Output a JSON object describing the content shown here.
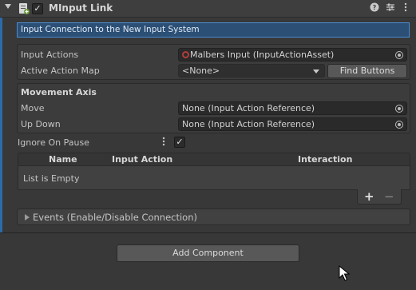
{
  "component": {
    "title": "MInput Link",
    "enabled_mark": "✓",
    "description": "Input Connection to the New Input System"
  },
  "header_icons": [
    "help-icon",
    "preset-icon",
    "context-menu-icon"
  ],
  "fields": {
    "input_actions_label": "Input Actions",
    "input_actions_value": "Malbers Input (InputActionAsset)",
    "active_action_map_label": "Active Action Map",
    "active_action_map_value": "<None>",
    "find_buttons_label": "Find Buttons"
  },
  "movement_axis": {
    "section_title": "Movement Axis",
    "move_label": "Move",
    "move_value": "None (Input Action Reference)",
    "up_down_label": "Up Down",
    "up_down_value": "None (Input Action Reference)"
  },
  "ignore_on_pause": {
    "label": "Ignore On Pause",
    "checked_mark": "✓"
  },
  "table": {
    "columns": [
      "Name",
      "Input Action",
      "Interaction"
    ],
    "empty_text": "List is Empty",
    "add_label": "+",
    "remove_label": "−"
  },
  "events": {
    "label": "Events (Enable/Disable Connection)"
  },
  "add_component_label": "Add Component",
  "colors": {
    "accent": "#2d6aa8",
    "description_bg": "#2c4f75"
  }
}
